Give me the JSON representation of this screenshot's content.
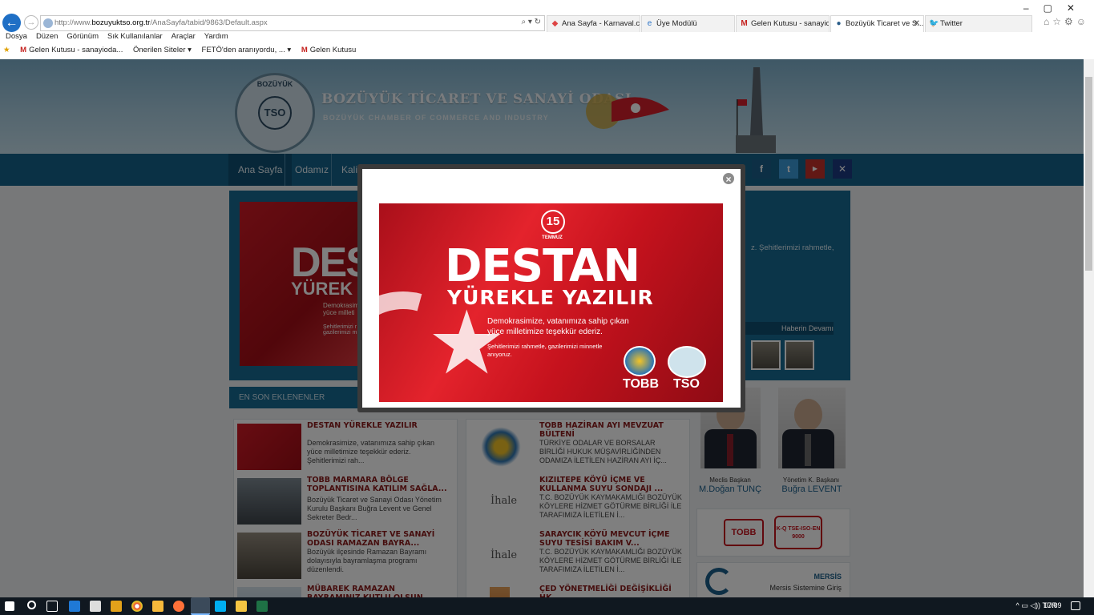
{
  "browser": {
    "url_prefix": "http://www.",
    "url_domain": "bozuyuktso.org.tr",
    "url_path": "/AnaSayfa/tabid/9863/Default.aspx",
    "tabs": [
      {
        "label": "Ana Sayfa - Karnaval.com"
      },
      {
        "label": "Üye Modülü"
      },
      {
        "label": "Gelen Kutusu - sanayiod..."
      },
      {
        "label": "Bozüyük Ticaret ve S..."
      },
      {
        "label": "Twitter"
      }
    ],
    "menu": [
      "Dosya",
      "Düzen",
      "Görünüm",
      "Sık Kullanılanlar",
      "Araçlar",
      "Yardım"
    ],
    "favorites": [
      "Gelen Kutusu - sanayioda...",
      "Önerilen Siteler ▾",
      "FETÖ'den aranıyordu, ... ▾",
      "Gelen Kutusu"
    ]
  },
  "site": {
    "title": "BOZÜYÜK TİCARET VE SANAYİ ODASI",
    "subtitle": "BOZÜYÜK CHAMBER OF COMMERCE AND INDUSTRY",
    "logo_top": "BOZÜYÜK",
    "logo_mid": "TSO",
    "nav": [
      "Ana Sayfa",
      "Odamız",
      "Kalit"
    ],
    "slide_text": "z. Şehitlerimizi rahmetle,",
    "slide_more": "Haberin Devamı",
    "slide_img_t1": "DES",
    "slide_img_t2": "YÜREK",
    "slide_img_t3": "Demokrasimize yüce milleti",
    "slide_img_t4": "Şehitlerimizi r gazilerimizi m",
    "section_title": "EN SON EKLENENLER"
  },
  "news_left": [
    {
      "title": "DESTAN YÜREKLE YAZILIR",
      "desc": "Demokrasimize, vatanımıza sahip çıkan yüce milletimize teşekkür ederiz. Şehitlerimizi rah..."
    },
    {
      "title": "TOBB MARMARA BÖLGE TOPLANTISINA KATILIM SAĞLA...",
      "desc": "Bozüyük Ticaret ve Sanayi Odası Yönetim Kurulu Başkanı Buğra Levent ve Genel Sekreter Bedr..."
    },
    {
      "title": "BOZÜYÜK TİCARET VE SANAYİ ODASI RAMAZAN BAYRA...",
      "desc": "Bozüyük ilçesinde Ramazan Bayramı dolayısıyla bayramlaşma programı düzenlendi."
    },
    {
      "title": "MÜBAREK RAMAZAN BAYRAMINIZ KUTLU OLSUN",
      "desc": ""
    }
  ],
  "news_right": [
    {
      "title": "TOBB HAZİRAN AYI MEVZUAT BÜLTENİ",
      "desc": "TÜRKİYE ODALAR VE BORSALAR BİRLİĞİ HUKUK MÜŞAVİRLİĞİNDEN ODAMIZA İLETİLEN HAZİRAN AYI İÇ..."
    },
    {
      "title": "KIZILTEPE KÖYÜ İÇME VE KULLANMA SUYU SONDAJI ...",
      "desc": "T.C. BOZÜYÜK KAYMAKAMLIĞI BOZÜYÜK KÖYLERE HİZMET GÖTÜRME BİRLİĞİ İLE TARAFIMIZA İLETİLEN İ..."
    },
    {
      "title": "SARAYCIK KÖYÜ MEVCUT İÇME SUYU TESİSİ BAKIM V...",
      "desc": "T.C. BOZÜYÜK KAYMAKAMLIĞI BOZÜYÜK KÖYLERE HİZMET GÖTÜRME BİRLİĞİ İLE TARAFIMIZA İLETİLEN İ..."
    },
    {
      "title": "ÇED YÖNETMELİĞİ DEĞİŞİKLİĞİ HK",
      "desc": ""
    }
  ],
  "ihale_label": "İhale İlanı",
  "people": [
    {
      "role": "Meclis Başkan",
      "name": "M.Doğan TUNÇ"
    },
    {
      "role": "Yönetim K. Başkanı",
      "name": "Buğra LEVENT"
    }
  ],
  "badges": {
    "tobb": "TOBB",
    "kq": "K-Q TSE-ISO-EN 9000"
  },
  "mersis": {
    "title": "MERSİS",
    "sub": "Mersis Sistemine Giriş"
  },
  "modal": {
    "logo": "15",
    "date": "TEMMUZ",
    "t1": "DESTAN",
    "t2": "YÜREKLE YAZILIR",
    "t3": "Demokrasimize, vatanımıza sahip çıkan yüce milletimize teşekkür ederiz.",
    "t4": "Şehitlerimizi rahmetle, gazilerimizi minnetle anıyoruz.",
    "tobb": "TOBB",
    "tso": "TSO",
    "close": "×"
  },
  "taskbar": {
    "lang": "TUR",
    "time": "17:09"
  }
}
